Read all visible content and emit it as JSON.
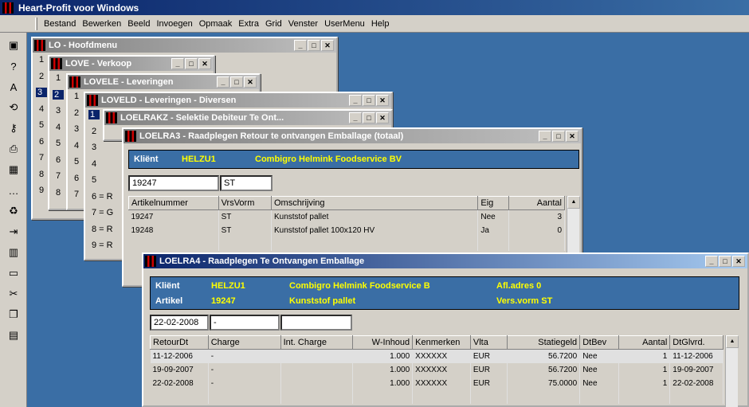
{
  "app": {
    "title": "Heart-Profit voor Windows"
  },
  "menu": [
    "Bestand",
    "Bewerken",
    "Beeld",
    "Invoegen",
    "Opmaak",
    "Extra",
    "Grid",
    "Venster",
    "UserMenu",
    "Help"
  ],
  "toolbar": [
    "monitor-icon",
    "help-icon",
    "font-icon",
    "refresh-icon",
    "key-icon",
    "print-icon",
    "calendar-icon",
    "dots-icon",
    "recycle-icon",
    "export-icon",
    "chart-icon",
    "window-icon",
    "cut-icon",
    "copy-icon",
    "paste-icon"
  ],
  "windows": {
    "lo": {
      "title": "LO - Hoofdmenu",
      "items": [
        "1",
        "2",
        "3",
        "4",
        "5",
        "6",
        "7",
        "8",
        "9"
      ]
    },
    "love": {
      "title": "LOVE - Verkoop",
      "items": [
        "1",
        "2",
        "3",
        "4",
        "5",
        "6",
        "7",
        "8"
      ]
    },
    "lovele": {
      "title": "LOVELE - Leveringen",
      "items": [
        "1",
        "2",
        "3",
        "4",
        "5",
        "6",
        "7"
      ]
    },
    "loveld": {
      "title": "LOVELD - Leveringen - Diversen",
      "items": [
        "1",
        "2",
        "3",
        "4",
        "5",
        "6 = R",
        "7 = G",
        "8 = R",
        "9 = R"
      ]
    },
    "loelrakz": {
      "title": "LOELRAKZ - Selektie Debiteur Te Ont..."
    },
    "loelra3": {
      "title": "LOELRA3 - Raadplegen Retour te ontvangen Emballage (totaal)",
      "client_label": "Kliënt",
      "client_code": "HELZU1",
      "client_name": "Combigro Helmink Foodservice BV",
      "field1": "19247",
      "field2": "ST",
      "headers": [
        "Artikelnummer",
        "VrsVorm",
        "Omschrijving",
        "Eig",
        "Aantal"
      ],
      "rows": [
        [
          "19247",
          "ST",
          "Kunststof pallet",
          "Nee",
          "3"
        ],
        [
          "19248",
          "ST",
          "Kunststof pallet 100x120 HV",
          "Ja",
          "0"
        ]
      ]
    },
    "loelra4": {
      "title": "LOELRA4 - Raadplegen Te Ontvangen Emballage",
      "client_label": "Kliënt",
      "client_code": "HELZU1",
      "client_name": "Combigro Helmink Foodservice B",
      "afl_label": "Afl.adres 0",
      "art_label": "Artikel",
      "art_code": "19247",
      "art_name": "Kunststof pallet",
      "vers_label": "Vers.vorm ST",
      "date": "22-02-2008",
      "dash": "-",
      "blank": "",
      "headers": [
        "RetourDt",
        "Charge",
        "Int. Charge",
        "W-Inhoud",
        "Kenmerken",
        "Vlta",
        "Statiegeld",
        "DtBev",
        "Aantal",
        "DtGlvrd."
      ],
      "rows": [
        [
          "11-12-2006",
          "-",
          "",
          "1.000",
          "XXXXXX",
          "EUR",
          "56.7200",
          "Nee",
          "1",
          "11-12-2006"
        ],
        [
          "19-09-2007",
          "-",
          "",
          "1.000",
          "XXXXXX",
          "EUR",
          "56.7200",
          "Nee",
          "1",
          "19-09-2007"
        ],
        [
          "22-02-2008",
          "-",
          "",
          "1.000",
          "XXXXXX",
          "EUR",
          "75.0000",
          "Nee",
          "1",
          "22-02-2008"
        ]
      ]
    }
  }
}
